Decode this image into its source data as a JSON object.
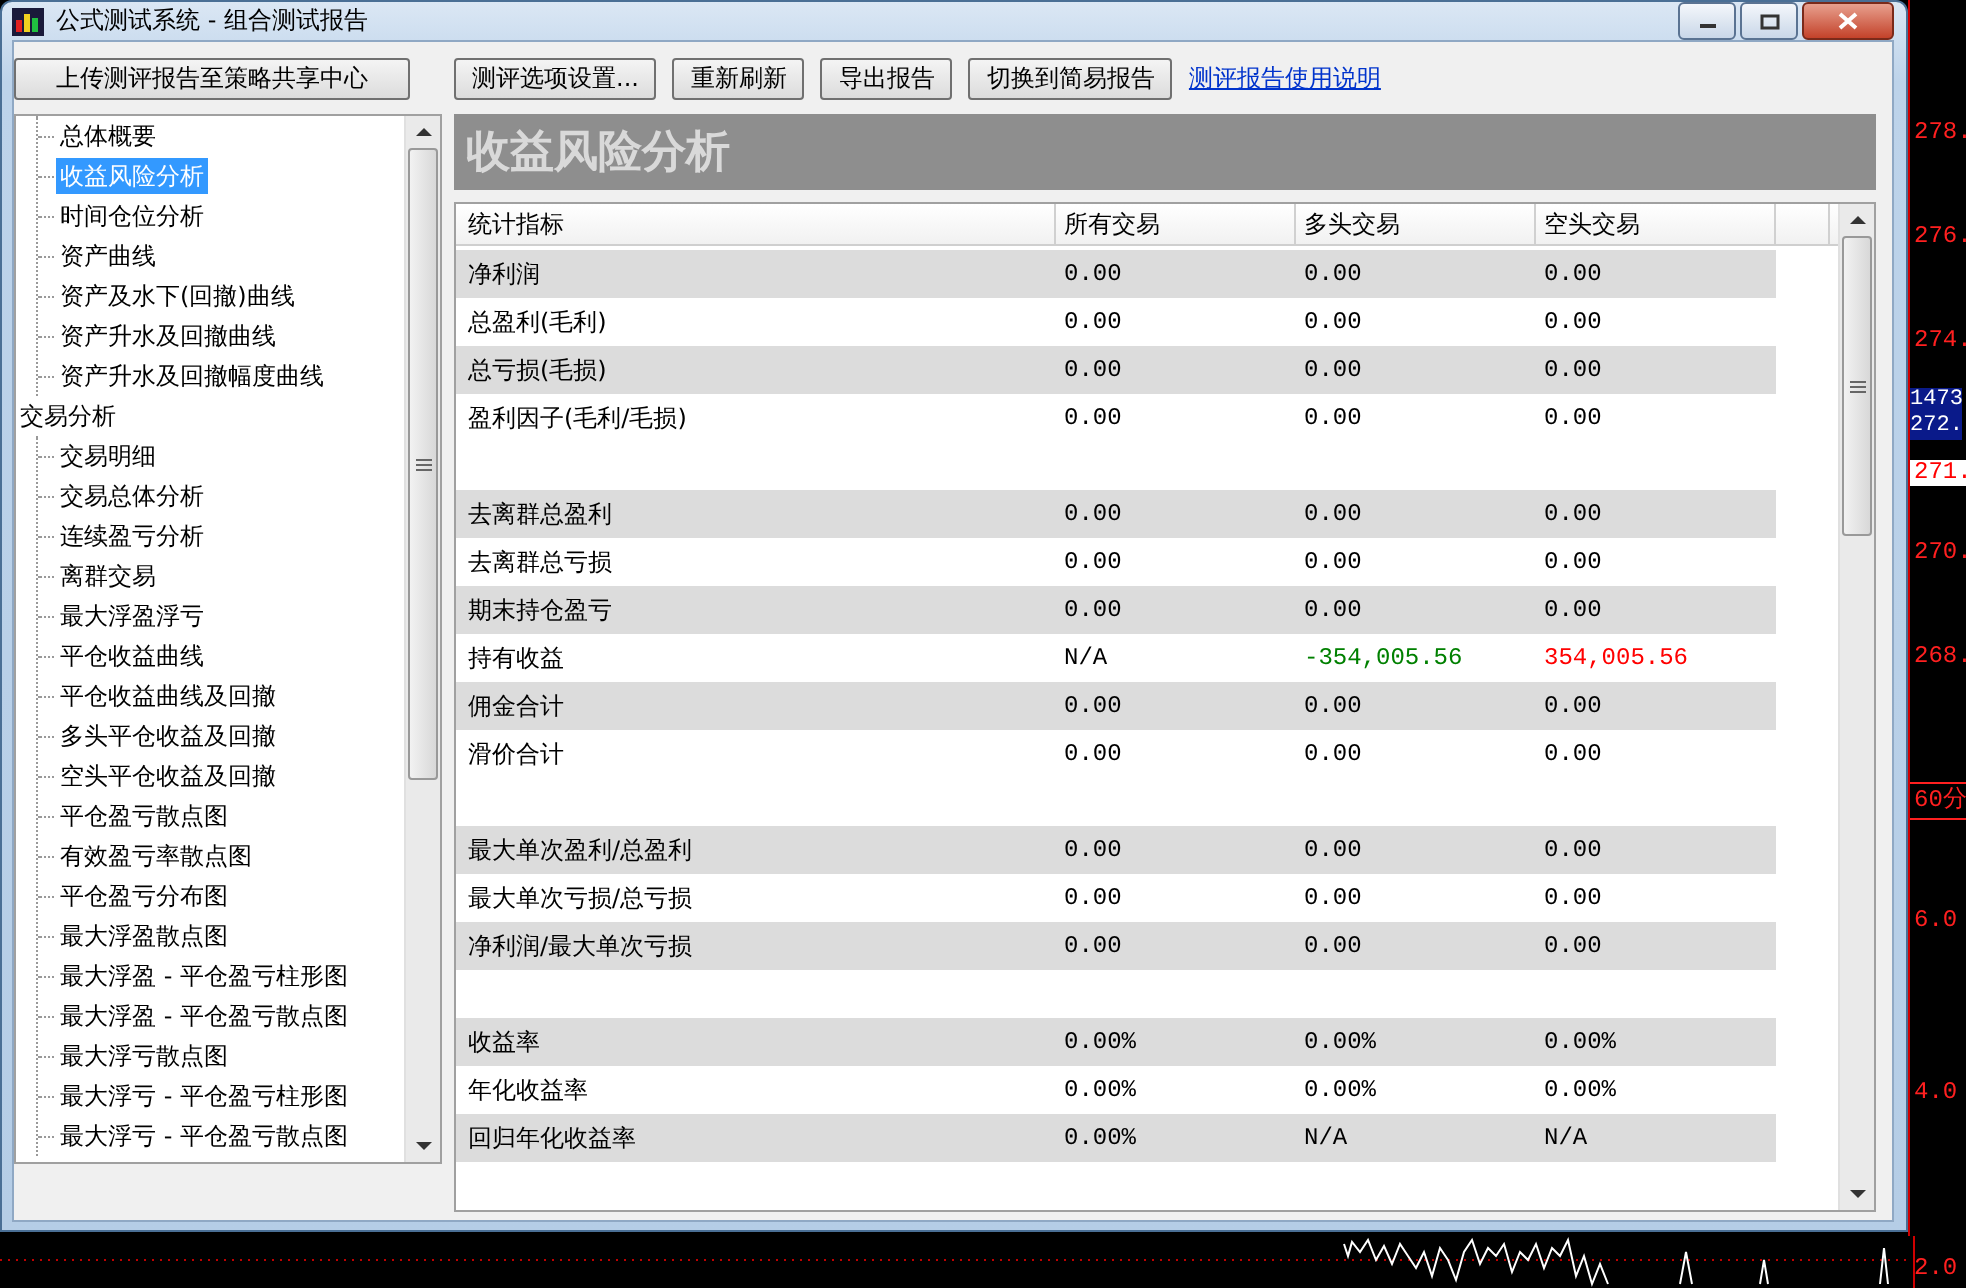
{
  "window": {
    "title": "公式测试系统 - 组合测试报告"
  },
  "toolbar": {
    "buttons": [
      "上传测评报告至策略共享中心",
      "测评选项设置...",
      "重新刷新",
      "导出报告",
      "切换到简易报告"
    ],
    "link": "测评报告使用说明"
  },
  "tree": [
    {
      "children": [
        {
          "label": "总体概要",
          "selected": false
        },
        {
          "label": "收益风险分析",
          "selected": true
        },
        {
          "label": "时间仓位分析",
          "selected": false
        },
        {
          "label": "资产曲线",
          "selected": false
        },
        {
          "label": "资产及水下(回撤)曲线",
          "selected": false
        },
        {
          "label": "资产升水及回撤曲线",
          "selected": false
        },
        {
          "label": "资产升水及回撤幅度曲线",
          "selected": false
        }
      ]
    },
    {
      "label": "交易分析",
      "selected": false,
      "children": [
        {
          "label": "交易明细",
          "selected": false
        },
        {
          "label": "交易总体分析",
          "selected": false
        },
        {
          "label": "连续盈亏分析",
          "selected": false
        },
        {
          "label": "离群交易",
          "selected": false
        },
        {
          "label": "最大浮盈浮亏",
          "selected": false
        },
        {
          "label": "平仓收益曲线",
          "selected": false
        },
        {
          "label": "平仓收益曲线及回撤",
          "selected": false
        },
        {
          "label": "多头平仓收益及回撤",
          "selected": false
        },
        {
          "label": "空头平仓收益及回撤",
          "selected": false
        },
        {
          "label": "平仓盈亏散点图",
          "selected": false
        },
        {
          "label": "有效盈亏率散点图",
          "selected": false
        },
        {
          "label": "平仓盈亏分布图",
          "selected": false
        },
        {
          "label": "最大浮盈散点图",
          "selected": false
        },
        {
          "label": "最大浮盈 - 平仓盈亏柱形图",
          "selected": false
        },
        {
          "label": "最大浮盈 - 平仓盈亏散点图",
          "selected": false
        },
        {
          "label": "最大浮亏散点图",
          "selected": false
        },
        {
          "label": "最大浮亏 - 平仓盈亏柱形图",
          "selected": false
        },
        {
          "label": "最大浮亏 - 平仓盈亏散点图",
          "selected": false
        }
      ]
    }
  ],
  "report": {
    "title": "收益风险分析",
    "columns": [
      "统计指标",
      "所有交易",
      "多头交易",
      "空头交易"
    ],
    "groups": [
      [
        {
          "label": "净利润",
          "values": [
            "0.00",
            "0.00",
            "0.00"
          ]
        },
        {
          "label": "总盈利(毛利)",
          "values": [
            "0.00",
            "0.00",
            "0.00"
          ]
        },
        {
          "label": "总亏损(毛损)",
          "values": [
            "0.00",
            "0.00",
            "0.00"
          ]
        },
        {
          "label": "盈利因子(毛利/毛损)",
          "values": [
            "0.00",
            "0.00",
            "0.00"
          ]
        }
      ],
      [
        {
          "label": "去离群总盈利",
          "values": [
            "0.00",
            "0.00",
            "0.00"
          ]
        },
        {
          "label": "去离群总亏损",
          "values": [
            "0.00",
            "0.00",
            "0.00"
          ]
        },
        {
          "label": "期末持仓盈亏",
          "values": [
            "0.00",
            "0.00",
            "0.00"
          ]
        },
        {
          "label": "持有收益",
          "values": [
            "N/A",
            {
              "text": "-354,005.56",
              "color": "#008000"
            },
            {
              "text": "354,005.56",
              "color": "#ff0000"
            }
          ]
        },
        {
          "label": "佣金合计",
          "values": [
            "0.00",
            "0.00",
            "0.00"
          ]
        },
        {
          "label": "滑价合计",
          "values": [
            "0.00",
            "0.00",
            "0.00"
          ]
        }
      ],
      [
        {
          "label": "最大单次盈利/总盈利",
          "values": [
            "0.00",
            "0.00",
            "0.00"
          ]
        },
        {
          "label": "最大单次亏损/总亏损",
          "values": [
            "0.00",
            "0.00",
            "0.00"
          ]
        },
        {
          "label": "净利润/最大单次亏损",
          "values": [
            "0.00",
            "0.00",
            "0.00"
          ]
        }
      ],
      [
        {
          "label": "收益率",
          "values": [
            "0.00%",
            "0.00%",
            "0.00%"
          ]
        },
        {
          "label": "年化收益率",
          "values": [
            "0.00%",
            "0.00%",
            "0.00%"
          ]
        },
        {
          "label": "回归年化收益率",
          "values": [
            "0.00%",
            "N/A",
            "N/A"
          ]
        }
      ]
    ]
  },
  "axis_labels": [
    {
      "text": "278.",
      "kind": "plain"
    },
    {
      "text": "276.",
      "kind": "plain"
    },
    {
      "text": "274.",
      "kind": "plain"
    },
    {
      "text": "1473",
      "kind": "tag-blue"
    },
    {
      "text": "272.",
      "kind": "tag-blue"
    },
    {
      "text": "271.",
      "kind": "tag-white"
    },
    {
      "text": "270.",
      "kind": "plain"
    },
    {
      "text": "268.",
      "kind": "plain"
    },
    {
      "text": "60分",
      "kind": "boxed"
    },
    {
      "text": "6.0",
      "kind": "plain"
    },
    {
      "text": "4.0",
      "kind": "plain"
    },
    {
      "text": "2.0",
      "kind": "plain"
    }
  ]
}
